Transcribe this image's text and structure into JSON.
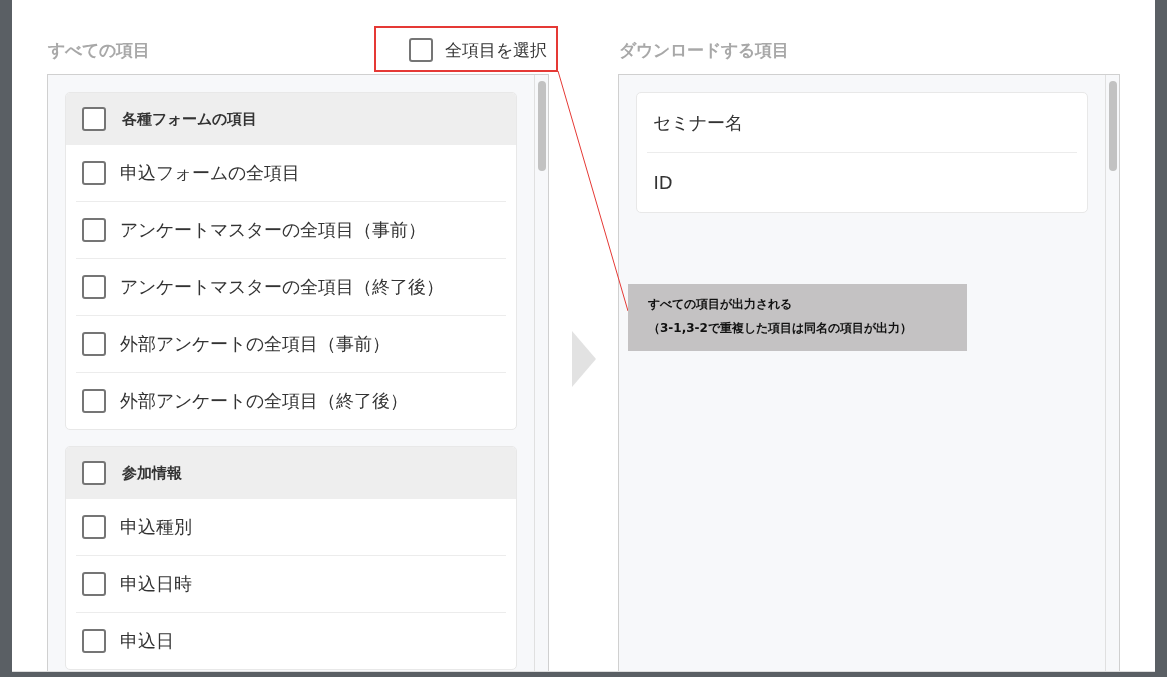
{
  "left_panel": {
    "title": "すべての項目",
    "select_all": {
      "label": "全項目を選択",
      "checked": false
    },
    "groups": [
      {
        "title": "各種フォームの項目",
        "checked": false,
        "items": [
          {
            "label": "申込フォームの全項目",
            "checked": false
          },
          {
            "label": "アンケートマスターの全項目（事前）",
            "checked": false
          },
          {
            "label": "アンケートマスターの全項目（終了後）",
            "checked": false
          },
          {
            "label": "外部アンケートの全項目（事前）",
            "checked": false
          },
          {
            "label": "外部アンケートの全項目（終了後）",
            "checked": false
          }
        ]
      },
      {
        "title": "参加情報",
        "checked": false,
        "items": [
          {
            "label": "申込種別",
            "checked": false
          },
          {
            "label": "申込日時",
            "checked": false
          },
          {
            "label": "申込日",
            "checked": false
          }
        ]
      }
    ]
  },
  "right_panel": {
    "title": "ダウンロードする項目",
    "items": [
      "セミナー名",
      "ID"
    ]
  },
  "annotation": {
    "lines": [
      "すべての項目が出力される",
      "（3-1,3-2で重複した項目は同名の項目が出力）"
    ]
  }
}
